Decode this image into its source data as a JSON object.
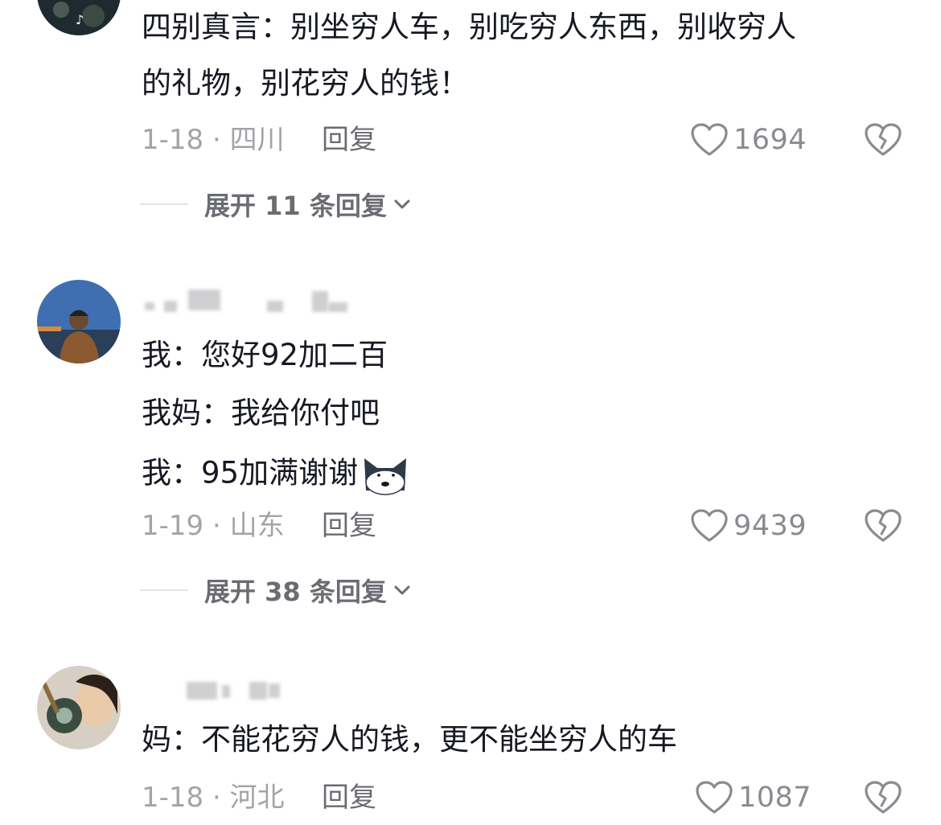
{
  "comments": [
    {
      "lines": [
        "四别真言：别坐穷人车，别吃穷人东西，别收穷人",
        "的礼物，别花穷人的钱！"
      ],
      "meta": "1-18 · 四川",
      "reply_label": "回复",
      "likes": "1694",
      "expand_label": "展开 11 条回复"
    },
    {
      "lines": [
        "我：您好92加二百",
        "我妈：我给你付吧",
        "我：95加满谢谢"
      ],
      "meta": "1-19 · 山东",
      "reply_label": "回复",
      "likes": "9439",
      "expand_label": "展开 38 条回复",
      "emoji": "husky-emoji"
    },
    {
      "lines": [
        "妈：不能花穷人的钱，更不能坐穷人的车"
      ],
      "meta": "1-18 · 河北",
      "reply_label": "回复",
      "likes": "1087"
    }
  ],
  "icons": {
    "like": "heart-outline-icon",
    "dislike": "broken-heart-icon",
    "expand": "chevron-down-icon"
  },
  "colors": {
    "text": "#161823",
    "meta": "#a3a4a8",
    "secondary": "#6b6c72"
  }
}
